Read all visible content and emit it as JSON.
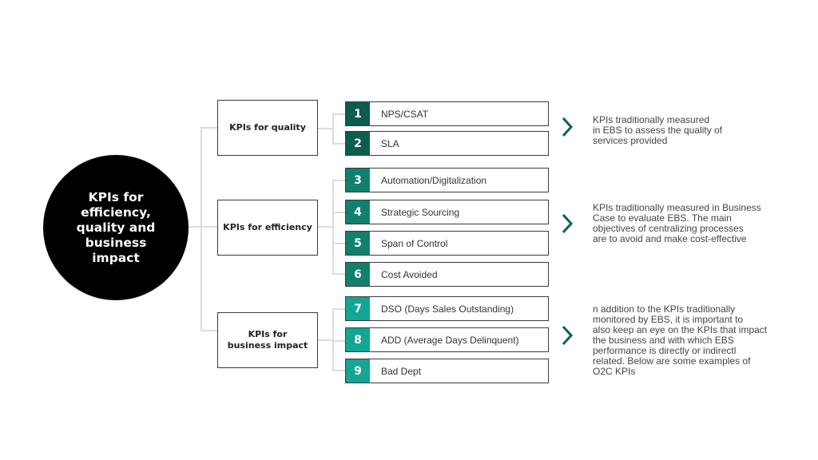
{
  "hub": {
    "label": "KPIs for efficiency, quality and business impact"
  },
  "colors": {
    "quality": "#0c5c50",
    "efficiency": "#12806f",
    "business": "#14a594",
    "chevron": "#0f5f55",
    "connector": "#dcdcdc"
  },
  "categories": [
    {
      "label": "KPIs for quality",
      "kpis": [
        {
          "num": "1",
          "label": "NPS/CSAT"
        },
        {
          "num": "2",
          "label": "SLA"
        }
      ],
      "description": "KPIs traditionally measured\nin EBS to assess the quality of\nservices provided"
    },
    {
      "label": "KPIs for efficiency",
      "kpis": [
        {
          "num": "3",
          "label": "Automation/Digitalization"
        },
        {
          "num": "4",
          "label": "Strategic Sourcing"
        },
        {
          "num": "5",
          "label": "Span of Control"
        },
        {
          "num": "6",
          "label": "Cost Avoided"
        }
      ],
      "description": "KPIs traditionally measured in Business\nCase to evaluate EBS. The main\nobjectives of centralizing processes\nare to avoid and make cost-effective"
    },
    {
      "label": "KPIs for business impact",
      "kpis": [
        {
          "num": "7",
          "label": "DSO (Days Sales Outstanding)"
        },
        {
          "num": "8",
          "label": "ADD (Average Days Delinquent)"
        },
        {
          "num": "9",
          "label": "Bad Dept"
        }
      ],
      "description": "n addition to the KPIs traditionally\nmonitored by EBS, it is important to\nalso keep an eye on the KPIs that impact\nthe business and with which EBS\nperformance is directly or indirectl\n related. Below are some examples of\nO2C KPIs"
    }
  ],
  "icons": {
    "chevron": "chevron-right-icon"
  }
}
